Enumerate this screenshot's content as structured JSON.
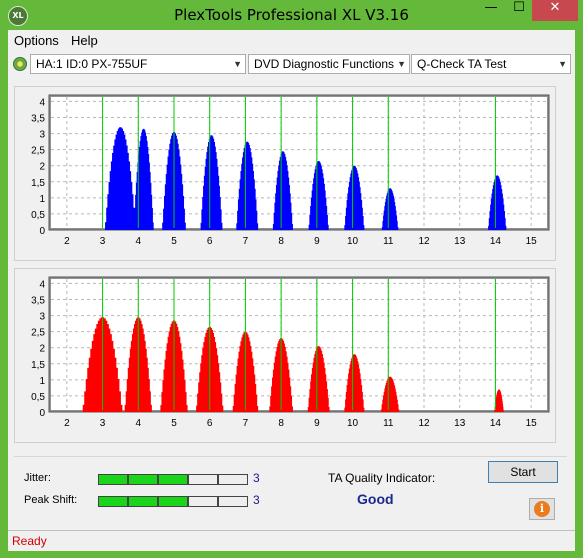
{
  "window": {
    "title": "PlexTools Professional XL V3.16",
    "icon_text": "XL",
    "minimize_glyph": "—",
    "maximize_glyph": "☐",
    "close_glyph": "✕"
  },
  "menu": [
    "Options",
    "Help"
  ],
  "toolbar": {
    "drive": "HA:1 ID:0  PX-755UF",
    "function": "DVD Diagnostic Functions",
    "test": "Q-Check TA Test"
  },
  "colors": {
    "top_chart": "#0000ff",
    "bottom_chart": "#ff0000",
    "guide_line": "#00cc00",
    "plot_background": "#8f9293",
    "window_accent": "#65b93a",
    "status_text": "#d00000"
  },
  "chart_data": [
    {
      "type": "area",
      "name": "top",
      "x_ticks": [
        "2",
        "3",
        "4",
        "5",
        "6",
        "7",
        "8",
        "9",
        "10",
        "11",
        "12",
        "13",
        "14",
        "15"
      ],
      "y_ticks": [
        "0",
        "0,5",
        "1",
        "1,5",
        "2",
        "2,5",
        "3",
        "3,5",
        "4"
      ],
      "xlim": [
        1.5,
        15.5
      ],
      "ylim": [
        0,
        4.2
      ],
      "guide_lines": [
        3,
        4,
        5,
        6,
        7,
        8,
        9,
        10,
        11,
        14
      ],
      "peaks": [
        {
          "x": 3.5,
          "height": 3.2,
          "width": 0.85
        },
        {
          "x": 4.15,
          "height": 3.15,
          "width": 0.55
        },
        {
          "x": 5.0,
          "height": 3.05,
          "width": 0.65
        },
        {
          "x": 6.05,
          "height": 2.95,
          "width": 0.6
        },
        {
          "x": 7.05,
          "height": 2.75,
          "width": 0.6
        },
        {
          "x": 8.05,
          "height": 2.45,
          "width": 0.55
        },
        {
          "x": 9.05,
          "height": 2.15,
          "width": 0.55
        },
        {
          "x": 10.05,
          "height": 2.0,
          "width": 0.55
        },
        {
          "x": 11.05,
          "height": 1.3,
          "width": 0.45
        },
        {
          "x": 14.05,
          "height": 1.7,
          "width": 0.5
        }
      ]
    },
    {
      "type": "area",
      "name": "bottom",
      "x_ticks": [
        "2",
        "3",
        "4",
        "5",
        "6",
        "7",
        "8",
        "9",
        "10",
        "11",
        "12",
        "13",
        "14",
        "15"
      ],
      "y_ticks": [
        "0",
        "0,5",
        "1",
        "1,5",
        "2",
        "2,5",
        "3",
        "3,5",
        "4"
      ],
      "xlim": [
        1.5,
        15.5
      ],
      "ylim": [
        0,
        4.2
      ],
      "guide_lines": [
        3,
        4,
        5,
        6,
        7,
        8,
        9,
        10,
        11,
        14
      ],
      "peaks": [
        {
          "x": 3.0,
          "height": 2.95,
          "width": 1.1
        },
        {
          "x": 4.0,
          "height": 2.95,
          "width": 0.75
        },
        {
          "x": 5.0,
          "height": 2.85,
          "width": 0.75
        },
        {
          "x": 6.0,
          "height": 2.65,
          "width": 0.75
        },
        {
          "x": 7.0,
          "height": 2.5,
          "width": 0.7
        },
        {
          "x": 8.0,
          "height": 2.3,
          "width": 0.65
        },
        {
          "x": 9.05,
          "height": 2.05,
          "width": 0.6
        },
        {
          "x": 10.05,
          "height": 1.8,
          "width": 0.55
        },
        {
          "x": 11.05,
          "height": 1.1,
          "width": 0.5
        },
        {
          "x": 14.1,
          "height": 0.7,
          "width": 0.25
        }
      ]
    }
  ],
  "metrics": {
    "jitter_label": "Jitter:",
    "jitter_value": "3",
    "jitter_level": 3,
    "peak_shift_label": "Peak Shift:",
    "peak_shift_value": "3",
    "peak_shift_level": 3,
    "meter_segments": 5
  },
  "quality": {
    "label": "TA Quality Indicator:",
    "value": "Good"
  },
  "buttons": {
    "start": "Start",
    "info_glyph": "i"
  },
  "status": "Ready"
}
